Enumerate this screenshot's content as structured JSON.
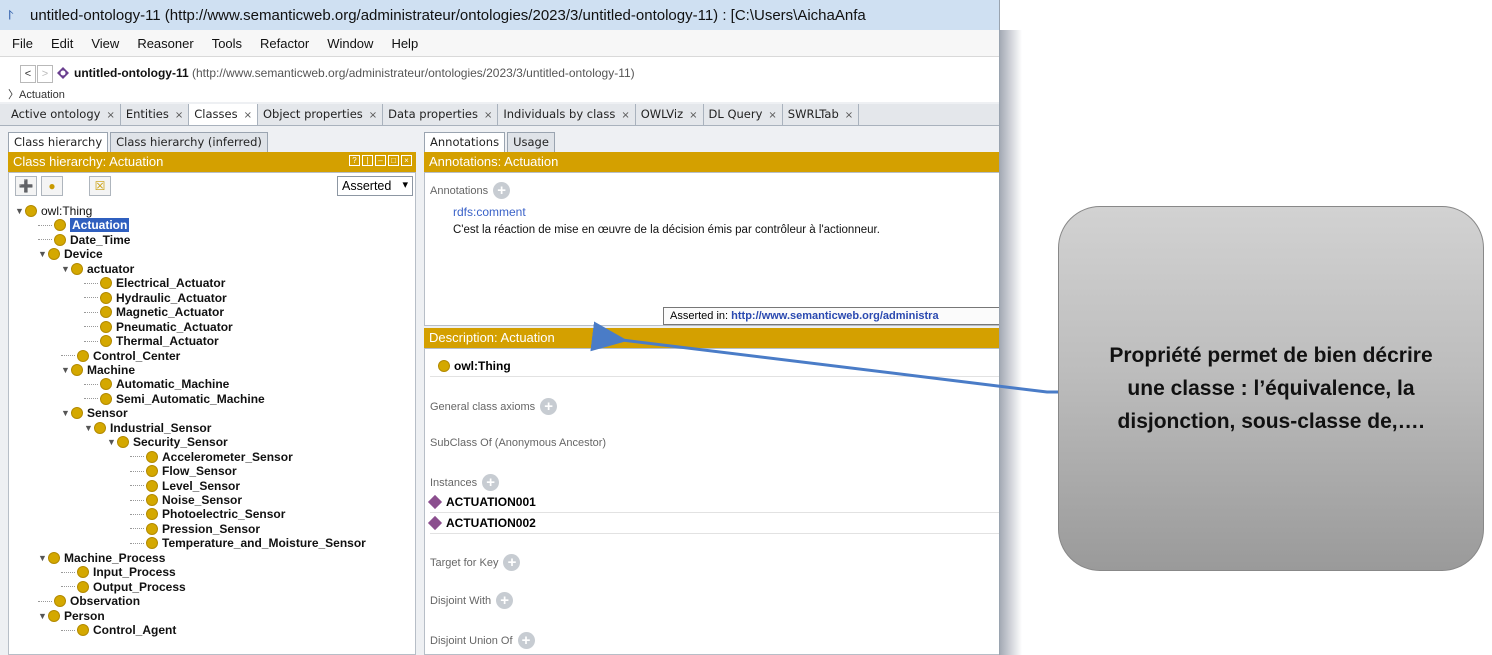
{
  "window": {
    "title": "untitled-ontology-11 (http://www.semanticweb.org/administrateur/ontologies/2023/3/untitled-ontology-11) : [C:\\Users\\AichaAnfa"
  },
  "menu": [
    "File",
    "Edit",
    "View",
    "Reasoner",
    "Tools",
    "Refactor",
    "Window",
    "Help"
  ],
  "nav": {
    "back": "<",
    "forward": ">",
    "ontology_name": "untitled-ontology-11",
    "ontology_iri": "(http://www.semanticweb.org/administrateur/ontologies/2023/3/untitled-ontology-11)",
    "breadcrumb": "Actuation"
  },
  "tabs": [
    {
      "label": "Active ontology",
      "active": false
    },
    {
      "label": "Entities",
      "active": false
    },
    {
      "label": "Classes",
      "active": true
    },
    {
      "label": "Object properties",
      "active": false
    },
    {
      "label": "Data properties",
      "active": false
    },
    {
      "label": "Individuals by class",
      "active": false
    },
    {
      "label": "OWLViz",
      "active": false
    },
    {
      "label": "DL Query",
      "active": false
    },
    {
      "label": "SWRLTab",
      "active": false
    }
  ],
  "tab_close": "×",
  "left": {
    "subtabs": [
      "Class hierarchy",
      "Class hierarchy (inferred)"
    ],
    "header": "Class hierarchy: Actuation",
    "dropdown": "Asserted",
    "tree": [
      {
        "label": "owl:Thing",
        "depth": 0,
        "expanded": true,
        "bold": false
      },
      {
        "label": "Actuation",
        "depth": 1,
        "selected": true
      },
      {
        "label": "Date_Time",
        "depth": 1
      },
      {
        "label": "Device",
        "depth": 1,
        "expanded": true
      },
      {
        "label": "actuator",
        "depth": 2,
        "expanded": true
      },
      {
        "label": "Electrical_Actuator",
        "depth": 3
      },
      {
        "label": "Hydraulic_Actuator",
        "depth": 3
      },
      {
        "label": "Magnetic_Actuator",
        "depth": 3
      },
      {
        "label": "Pneumatic_Actuator",
        "depth": 3
      },
      {
        "label": "Thermal_Actuator",
        "depth": 3
      },
      {
        "label": "Control_Center",
        "depth": 2
      },
      {
        "label": "Machine",
        "depth": 2,
        "expanded": true
      },
      {
        "label": "Automatic_Machine",
        "depth": 3
      },
      {
        "label": "Semi_Automatic_Machine",
        "depth": 3
      },
      {
        "label": "Sensor",
        "depth": 2,
        "expanded": true
      },
      {
        "label": "Industrial_Sensor",
        "depth": 3,
        "expanded": true
      },
      {
        "label": "Security_Sensor",
        "depth": 4,
        "expanded": true
      },
      {
        "label": "Accelerometer_Sensor",
        "depth": 5
      },
      {
        "label": "Flow_Sensor",
        "depth": 5
      },
      {
        "label": "Level_Sensor",
        "depth": 5
      },
      {
        "label": "Noise_Sensor",
        "depth": 5
      },
      {
        "label": "Photoelectric_Sensor",
        "depth": 5
      },
      {
        "label": "Pression_Sensor",
        "depth": 5
      },
      {
        "label": "Temperature_and_Moisture_Sensor",
        "depth": 5
      },
      {
        "label": "Machine_Process",
        "depth": 1,
        "expanded": true
      },
      {
        "label": "Input_Process",
        "depth": 2
      },
      {
        "label": "Output_Process",
        "depth": 2
      },
      {
        "label": "Observation",
        "depth": 1
      },
      {
        "label": "Person",
        "depth": 1,
        "expanded": true
      },
      {
        "label": "Control_Agent",
        "depth": 2
      }
    ]
  },
  "right": {
    "subtabs": [
      "Annotations",
      "Usage"
    ],
    "annotations_header": "Annotations: Actuation",
    "annotations_label": "Annotations",
    "annotation_property": "rdfs:comment",
    "annotation_value": "C'est la réaction de mise en œuvre de la décision émis par contrôleur à l'actionneur.",
    "asserted_in_label": "Asserted in:",
    "asserted_in_iri": "http://www.semanticweb.org/administra",
    "description_header": "Description: Actuation",
    "superclass": "owl:Thing",
    "sections": {
      "general_class_axioms": "General class axioms",
      "subclass_anon": "SubClass Of (Anonymous Ancestor)",
      "instances": "Instances",
      "target_for_key": "Target for Key",
      "disjoint_with": "Disjoint With",
      "disjoint_union_of": "Disjoint Union Of"
    },
    "instances": [
      "ACTUATION001",
      "ACTUATION002"
    ]
  },
  "callout": {
    "text": "Propriété permet de bien décrire une classe : l’équivalence, la disjonction, sous-classe de,…."
  },
  "colors": {
    "gold": "#d4a000",
    "selection": "#2f5fbf",
    "arrow": "#4a7cc7",
    "individual": "#8b4e8e"
  }
}
